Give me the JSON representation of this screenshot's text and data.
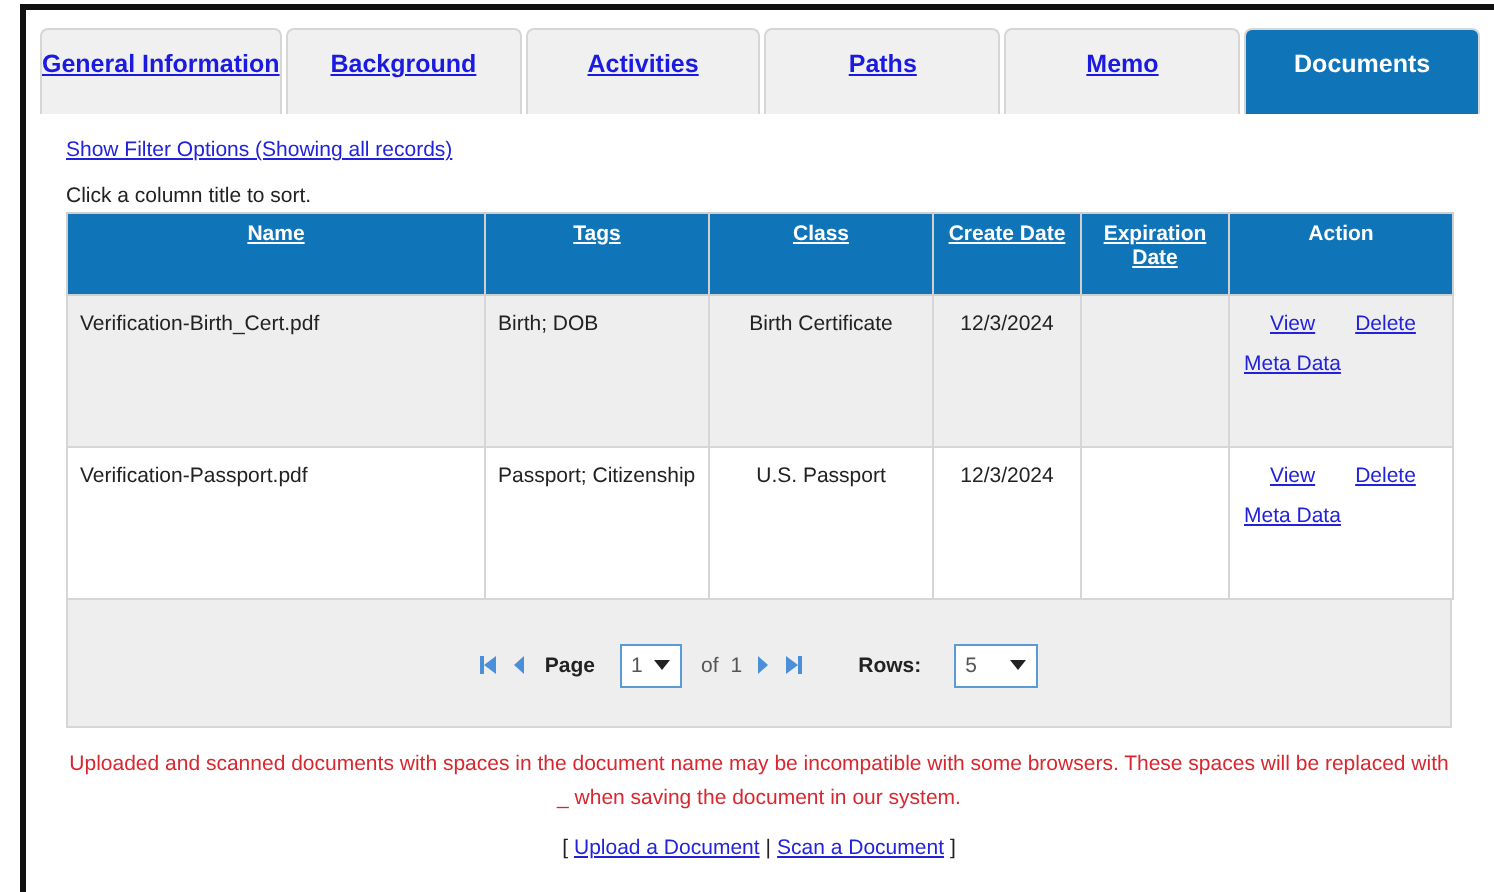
{
  "tabs": [
    {
      "label": "General Information",
      "selected": false
    },
    {
      "label": "Background",
      "selected": false
    },
    {
      "label": "Activities",
      "selected": false
    },
    {
      "label": "Paths",
      "selected": false
    },
    {
      "label": "Memo",
      "selected": false
    },
    {
      "label": "Documents",
      "selected": true
    }
  ],
  "filter_link": "Show Filter Options (Showing all records)",
  "sort_hint": "Click a column title to sort.",
  "table": {
    "columns": [
      {
        "label": "Name",
        "sortable": true
      },
      {
        "label": "Tags",
        "sortable": true
      },
      {
        "label": "Class",
        "sortable": true
      },
      {
        "label": "Create Date",
        "sortable": true
      },
      {
        "label": "Expiration Date",
        "sortable": true
      },
      {
        "label": "Action",
        "sortable": false
      }
    ],
    "rows": [
      {
        "name": "Verification-Birth_Cert.pdf",
        "tags": "Birth; DOB",
        "class": "Birth Certificate",
        "create_date": "12/3/2024",
        "actions": [
          "View",
          "Delete",
          "Meta Data"
        ]
      },
      {
        "name": "Verification-Passport.pdf",
        "tags": "Passport; Citizenship",
        "class": "U.S. Passport",
        "create_date": "12/3/2024",
        "actions": [
          "View",
          "Delete",
          "Meta Data"
        ]
      }
    ]
  },
  "pager": {
    "page_label": "Page",
    "page": "1",
    "of": "of",
    "total": "1",
    "rows_label": "Rows:",
    "rows": "5"
  },
  "notice": "Uploaded and scanned documents with spaces in the document name may be incompatible with some browsers. These spaces will be replaced with _ when saving the document in our system.",
  "footer": {
    "open": "[",
    "links": [
      "Upload a Document",
      "Scan a Document"
    ],
    "separator": "|",
    "close": "]"
  }
}
